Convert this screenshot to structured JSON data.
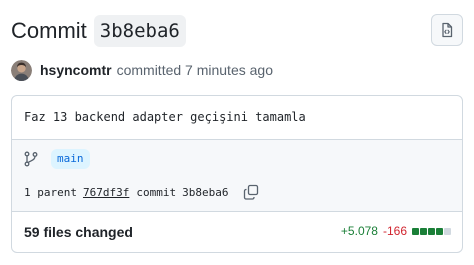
{
  "header": {
    "title_word": "Commit",
    "sha": "3b8eba6",
    "browse_icon": "file-code-icon"
  },
  "author": {
    "name": "hsyncomtr",
    "action": "committed 7 minutes ago"
  },
  "commit": {
    "message": "Faz 13 backend adapter geçişini tamamla",
    "branch": "main",
    "parent_label": "1 parent",
    "parent_sha": "767df3f",
    "commit_label": "commit",
    "commit_sha": "3b8eba6"
  },
  "files": {
    "changed_label": "59 files changed",
    "additions": "+5.078",
    "deletions": "-166",
    "blocks": [
      "green",
      "green",
      "green",
      "green",
      "gray"
    ]
  },
  "colors": {
    "green": "#1a7f37",
    "gray": "#d1d9e0",
    "accent": "#0969da"
  }
}
